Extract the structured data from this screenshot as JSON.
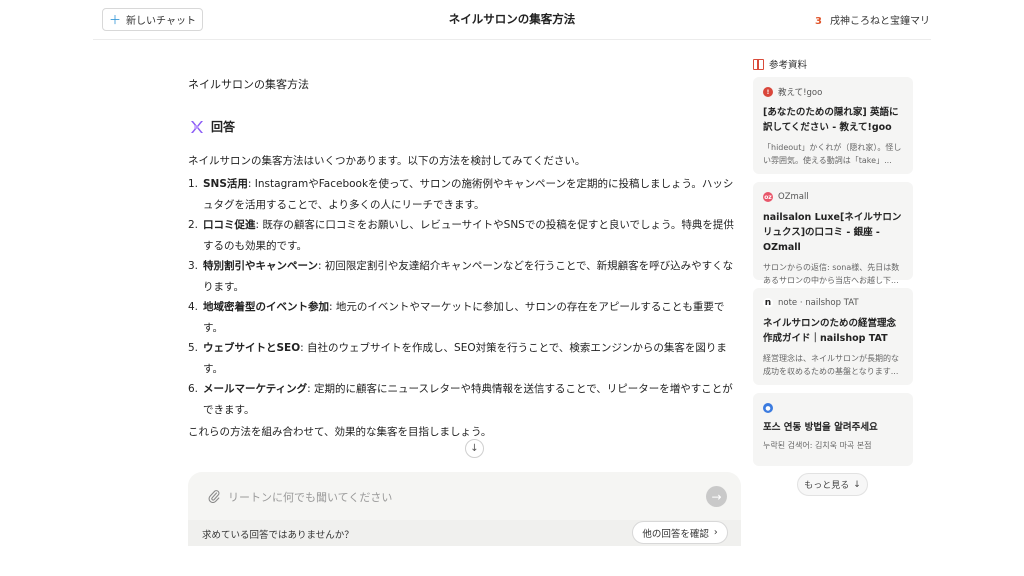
{
  "header": {
    "new_chat_label": "新しいチャット",
    "title": "ネイルサロンの集客方法",
    "right_number": "3",
    "right_text": "戌神ころねと宝鐘マリン"
  },
  "main": {
    "question": "ネイルサロンの集客方法",
    "answer_heading": "回答",
    "intro": "ネイルサロンの集客方法はいくつかあります。以下の方法を検討してみてください。",
    "items": [
      {
        "num": "1.",
        "bold": "SNS活用",
        "text": ": InstagramやFacebookを使って、サロンの施術例やキャンペーンを定期的に投稿しましょう。ハッシュタグを活用することで、より多くの人にリーチできます。"
      },
      {
        "num": "2.",
        "bold": "口コミ促進",
        "text": ": 既存の顧客に口コミをお願いし、レビューサイトやSNSでの投稿を促すと良いでしょう。特典を提供するのも効果的です。"
      },
      {
        "num": "3.",
        "bold": "特別割引やキャンペーン",
        "text": ": 初回限定割引や友達紹介キャンペーンなどを行うことで、新規顧客を呼び込みやすくなります。"
      },
      {
        "num": "4.",
        "bold": "地域密着型のイベント参加",
        "text": ": 地元のイベントやマーケットに参加し、サロンの存在をアピールすることも重要です。"
      },
      {
        "num": "5.",
        "bold": "ウェブサイトとSEO",
        "text": ": 自社のウェブサイトを作成し、SEO対策を行うことで、検索エンジンからの集客を図ります。"
      },
      {
        "num": "6.",
        "bold": "メールマーケティング",
        "text": ": 定期的に顧客にニュースレターや特典情報を送信することで、リピーターを増やすことができます。"
      }
    ],
    "outro": "これらの方法を組み合わせて、効果的な集客を目指しましょう。",
    "input_placeholder": "リートンに何でも聞いてください",
    "feedback_question": "求めている回答ではありませんか？",
    "other_answer_label": "他の回答を確認"
  },
  "references": {
    "title": "参考資料",
    "cards": [
      {
        "source": "教えて!goo",
        "title": "[あなたのための隠れ家] 英語に訳してください - 教えて!goo",
        "desc": "「hideout」かくれが（隠れ家）。怪しい雰囲気。使える動詞は「take」...",
        "fav_color": "#d9463a"
      },
      {
        "source": "OZmall",
        "title": "nailsalon Luxe[ネイルサロン リュクス]の口コミ - 銀座 - OZmall",
        "desc": "サロンからの返信: sona様、先日は数あるサロンの中から当店へお越し下...",
        "fav_color": "#e8566a"
      },
      {
        "source": "note · nailshop TAT",
        "title": "ネイルサロンのための経営理念作成ガイド｜nailshop TAT",
        "desc": "経営理念は、ネイルサロンが長期的な成功を収めるための基盤となります...",
        "fav_color": "#222222"
      },
      {
        "source": "",
        "title": "포스 연동 방법을 알려주세요",
        "desc": "누락된 검색어: 김치욱 마곡 본점",
        "fav_color": "#3b7be0"
      }
    ],
    "more_label": "もっと見る"
  },
  "colors": {
    "accent_orange": "#e0552b",
    "logo_purple": "#8b5cf6",
    "book_red": "#d94b3a"
  }
}
